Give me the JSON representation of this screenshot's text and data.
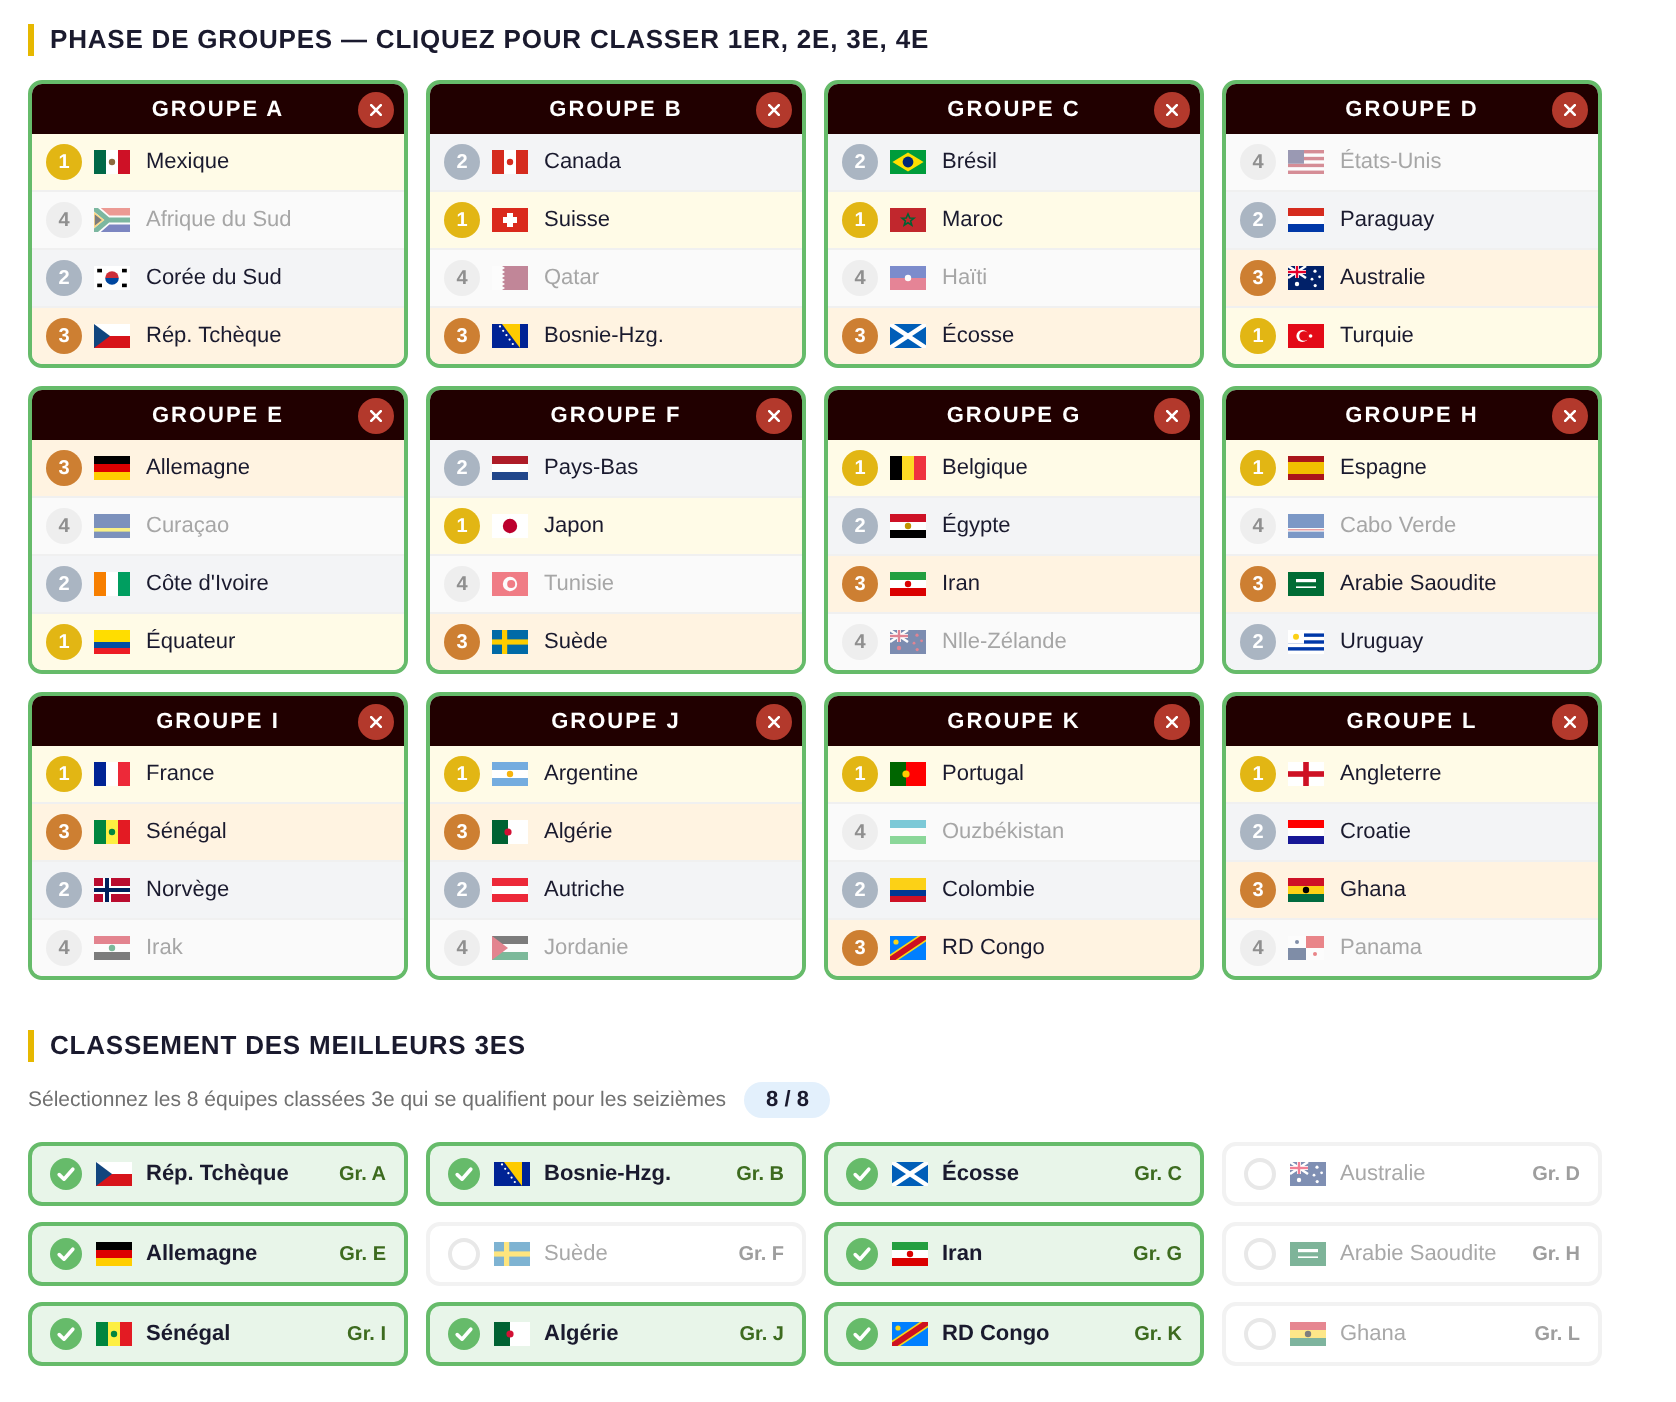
{
  "group_stage": {
    "title": "PHASE DE GROUPES — CLIQUEZ POUR CLASSER 1ER, 2E, 3E, 4E",
    "groups": [
      {
        "title": "GROUPE A",
        "teams": [
          {
            "rank": "1",
            "kind": "first",
            "name": "Mexique",
            "flag": {
              "kind": "mx"
            }
          },
          {
            "rank": "4",
            "kind": "out",
            "name": "Afrique du Sud",
            "flag": {
              "kind": "za"
            }
          },
          {
            "rank": "2",
            "kind": "second",
            "name": "Corée du Sud",
            "flag": {
              "kind": "kr"
            }
          },
          {
            "rank": "3",
            "kind": "third",
            "name": "Rép. Tchèque",
            "flag": {
              "kind": "cz"
            }
          }
        ]
      },
      {
        "title": "GROUPE B",
        "teams": [
          {
            "rank": "2",
            "kind": "second",
            "name": "Canada",
            "flag": {
              "kind": "ca"
            }
          },
          {
            "rank": "1",
            "kind": "first",
            "name": "Suisse",
            "flag": {
              "kind": "ch"
            }
          },
          {
            "rank": "4",
            "kind": "out",
            "name": "Qatar",
            "flag": {
              "kind": "qa"
            }
          },
          {
            "rank": "3",
            "kind": "third",
            "name": "Bosnie-Hzg.",
            "flag": {
              "kind": "ba"
            }
          }
        ]
      },
      {
        "title": "GROUPE C",
        "teams": [
          {
            "rank": "2",
            "kind": "second",
            "name": "Brésil",
            "flag": {
              "kind": "br"
            }
          },
          {
            "rank": "1",
            "kind": "first",
            "name": "Maroc",
            "flag": {
              "kind": "ma"
            }
          },
          {
            "rank": "4",
            "kind": "out",
            "name": "Haïti",
            "flag": {
              "kind": "ht"
            }
          },
          {
            "rank": "3",
            "kind": "third",
            "name": "Écosse",
            "flag": {
              "kind": "sco"
            }
          }
        ]
      },
      {
        "title": "GROUPE D",
        "teams": [
          {
            "rank": "4",
            "kind": "out",
            "name": "États-Unis",
            "flag": {
              "kind": "us"
            }
          },
          {
            "rank": "2",
            "kind": "second",
            "name": "Paraguay",
            "flag": {
              "kind": "py"
            }
          },
          {
            "rank": "3",
            "kind": "third",
            "name": "Australie",
            "flag": {
              "kind": "au"
            }
          },
          {
            "rank": "1",
            "kind": "first",
            "name": "Turquie",
            "flag": {
              "kind": "tr"
            }
          }
        ]
      },
      {
        "title": "GROUPE E",
        "teams": [
          {
            "rank": "3",
            "kind": "third",
            "name": "Allemagne",
            "flag": {
              "kind": "de"
            }
          },
          {
            "rank": "4",
            "kind": "out",
            "name": "Curaçao",
            "flag": {
              "kind": "cw"
            }
          },
          {
            "rank": "2",
            "kind": "second",
            "name": "Côte d'Ivoire",
            "flag": {
              "kind": "ci"
            }
          },
          {
            "rank": "1",
            "kind": "first",
            "name": "Équateur",
            "flag": {
              "kind": "ec"
            }
          }
        ]
      },
      {
        "title": "GROUPE F",
        "teams": [
          {
            "rank": "2",
            "kind": "second",
            "name": "Pays-Bas",
            "flag": {
              "kind": "nl"
            }
          },
          {
            "rank": "1",
            "kind": "first",
            "name": "Japon",
            "flag": {
              "kind": "jp"
            }
          },
          {
            "rank": "4",
            "kind": "out",
            "name": "Tunisie",
            "flag": {
              "kind": "tn"
            }
          },
          {
            "rank": "3",
            "kind": "third",
            "name": "Suède",
            "flag": {
              "kind": "se"
            }
          }
        ]
      },
      {
        "title": "GROUPE G",
        "teams": [
          {
            "rank": "1",
            "kind": "first",
            "name": "Belgique",
            "flag": {
              "kind": "be"
            }
          },
          {
            "rank": "2",
            "kind": "second",
            "name": "Égypte",
            "flag": {
              "kind": "eg"
            }
          },
          {
            "rank": "3",
            "kind": "third",
            "name": "Iran",
            "flag": {
              "kind": "ir"
            }
          },
          {
            "rank": "4",
            "kind": "out",
            "name": "Nlle-Zélande",
            "flag": {
              "kind": "nz"
            }
          }
        ]
      },
      {
        "title": "GROUPE H",
        "teams": [
          {
            "rank": "1",
            "kind": "first",
            "name": "Espagne",
            "flag": {
              "kind": "es"
            }
          },
          {
            "rank": "4",
            "kind": "out",
            "name": "Cabo Verde",
            "flag": {
              "kind": "cv"
            }
          },
          {
            "rank": "3",
            "kind": "third",
            "name": "Arabie Saoudite",
            "flag": {
              "kind": "sa"
            }
          },
          {
            "rank": "2",
            "kind": "second",
            "name": "Uruguay",
            "flag": {
              "kind": "uy"
            }
          }
        ]
      },
      {
        "title": "GROUPE I",
        "teams": [
          {
            "rank": "1",
            "kind": "first",
            "name": "France",
            "flag": {
              "kind": "fr"
            }
          },
          {
            "rank": "3",
            "kind": "third",
            "name": "Sénégal",
            "flag": {
              "kind": "sn"
            }
          },
          {
            "rank": "2",
            "kind": "second",
            "name": "Norvège",
            "flag": {
              "kind": "no"
            }
          },
          {
            "rank": "4",
            "kind": "out",
            "name": "Irak",
            "flag": {
              "kind": "iq"
            }
          }
        ]
      },
      {
        "title": "GROUPE J",
        "teams": [
          {
            "rank": "1",
            "kind": "first",
            "name": "Argentine",
            "flag": {
              "kind": "ar"
            }
          },
          {
            "rank": "3",
            "kind": "third",
            "name": "Algérie",
            "flag": {
              "kind": "dz"
            }
          },
          {
            "rank": "2",
            "kind": "second",
            "name": "Autriche",
            "flag": {
              "kind": "at"
            }
          },
          {
            "rank": "4",
            "kind": "out",
            "name": "Jordanie",
            "flag": {
              "kind": "jo"
            }
          }
        ]
      },
      {
        "title": "GROUPE K",
        "teams": [
          {
            "rank": "1",
            "kind": "first",
            "name": "Portugal",
            "flag": {
              "kind": "pt"
            }
          },
          {
            "rank": "4",
            "kind": "out",
            "name": "Ouzbékistan",
            "flag": {
              "kind": "uz"
            }
          },
          {
            "rank": "2",
            "kind": "second",
            "name": "Colombie",
            "flag": {
              "kind": "co"
            }
          },
          {
            "rank": "3",
            "kind": "third",
            "name": "RD Congo",
            "flag": {
              "kind": "cd"
            }
          }
        ]
      },
      {
        "title": "GROUPE L",
        "teams": [
          {
            "rank": "1",
            "kind": "first",
            "name": "Angleterre",
            "flag": {
              "kind": "eng"
            }
          },
          {
            "rank": "2",
            "kind": "second",
            "name": "Croatie",
            "flag": {
              "kind": "hr"
            }
          },
          {
            "rank": "3",
            "kind": "third",
            "name": "Ghana",
            "flag": {
              "kind": "gh"
            }
          },
          {
            "rank": "4",
            "kind": "out",
            "name": "Panama",
            "flag": {
              "kind": "pa"
            }
          }
        ]
      }
    ]
  },
  "best_thirds": {
    "title": "CLASSEMENT DES MEILLEURS 3ES",
    "subtitle": "Sélectionnez les 8 équipes classées 3e qui se qualifient pour les seizièmes",
    "counter": "8 / 8",
    "options": [
      {
        "name": "Rép. Tchèque",
        "group": "Gr. A",
        "selected": true,
        "flag": {
          "kind": "cz"
        }
      },
      {
        "name": "Bosnie-Hzg.",
        "group": "Gr. B",
        "selected": true,
        "flag": {
          "kind": "ba"
        }
      },
      {
        "name": "Écosse",
        "group": "Gr. C",
        "selected": true,
        "flag": {
          "kind": "sco"
        }
      },
      {
        "name": "Australie",
        "group": "Gr. D",
        "selected": false,
        "flag": {
          "kind": "au"
        }
      },
      {
        "name": "Allemagne",
        "group": "Gr. E",
        "selected": true,
        "flag": {
          "kind": "de"
        }
      },
      {
        "name": "Suède",
        "group": "Gr. F",
        "selected": false,
        "flag": {
          "kind": "se"
        }
      },
      {
        "name": "Iran",
        "group": "Gr. G",
        "selected": true,
        "flag": {
          "kind": "ir"
        }
      },
      {
        "name": "Arabie Saoudite",
        "group": "Gr. H",
        "selected": false,
        "flag": {
          "kind": "sa"
        }
      },
      {
        "name": "Sénégal",
        "group": "Gr. I",
        "selected": true,
        "flag": {
          "kind": "sn"
        }
      },
      {
        "name": "Algérie",
        "group": "Gr. J",
        "selected": true,
        "flag": {
          "kind": "dz"
        }
      },
      {
        "name": "RD Congo",
        "group": "Gr. K",
        "selected": true,
        "flag": {
          "kind": "cd"
        }
      },
      {
        "name": "Ghana",
        "group": "Gr. L",
        "selected": false,
        "flag": {
          "kind": "gh"
        }
      }
    ]
  }
}
